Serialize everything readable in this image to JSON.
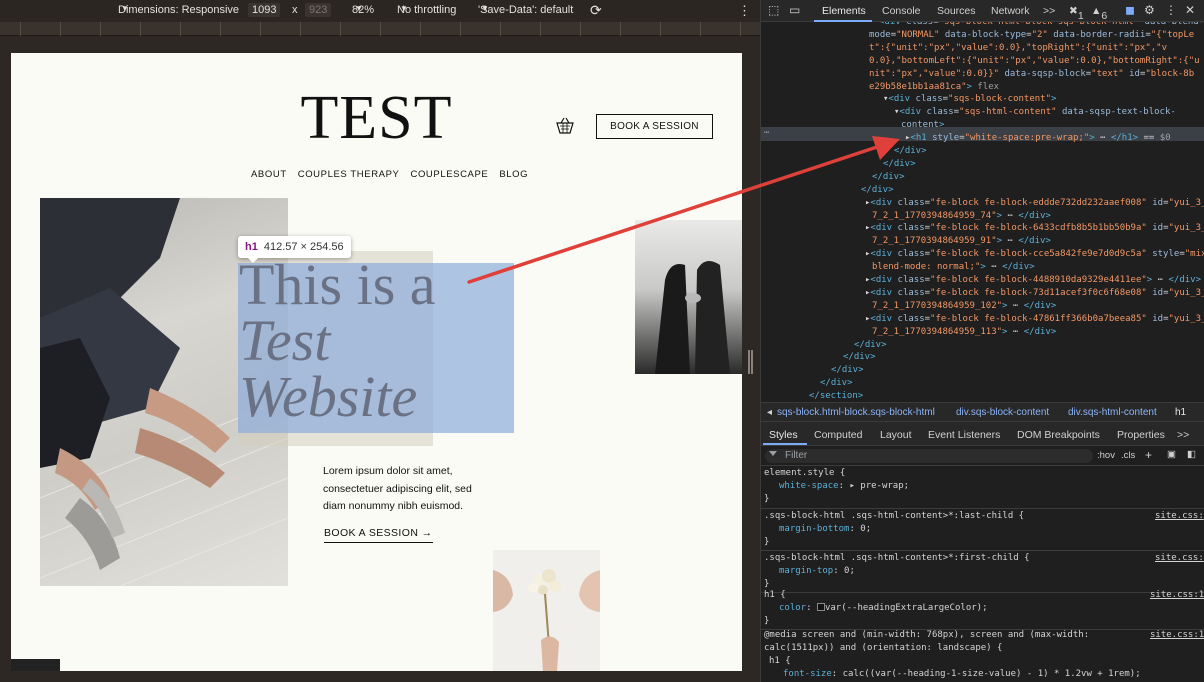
{
  "device_toolbar": {
    "dimensions_label": "Dimensions: Responsive",
    "width": "1093",
    "times": "x",
    "height": "923",
    "zoom": "82%",
    "throttling": "No throttling",
    "save_data": "'Save-Data': default"
  },
  "site": {
    "title": "TEST",
    "book_button": "BOOK A SESSION",
    "nav": [
      "ABOUT",
      "COUPLES THERAPY",
      "COUPLESCAPE",
      "BLOG"
    ],
    "hero_lines": [
      "This is a",
      "Test",
      "Website"
    ],
    "body_text": "Lorem ipsum dolor sit amet, consectetuer adipiscing elit, sed diam nonummy nibh euismod.",
    "link_label": "BOOK A SESSION →"
  },
  "highlight": {
    "tag": "h1",
    "size": "412.57 × 254.56"
  },
  "devtools": {
    "tabs": [
      "Elements",
      "Console",
      "Sources",
      "Network"
    ],
    "more_tabs": ">>",
    "error_count": "1",
    "warning_count": "6",
    "dom_lines": [
      {
        "html": "<span class='t'>&lt;div</span> <span class='a'>class</span>=<span class='v'>\"sqs-block html-block sqs-block-html\"</span> <span class='a'>data-blend-</span>"
      },
      {
        "html": "<span class='a'>mode</span>=<span class='v'>\"NORMAL\"</span> <span class='a'>data-block-type</span>=<span class='v'>\"2\"</span> <span class='a'>data-border-radii</span>=<span class='v'>\"{&quot;topLe</span>"
      },
      {
        "html": "<span class='v'>t&quot;:{&quot;unit&quot;:&quot;px&quot;,&quot;value&quot;:0.0},&quot;topRight&quot;:{&quot;unit&quot;:&quot;px&quot;,&quot;v</span>"
      },
      {
        "html": "<span class='v'>0.0},&quot;bottomLeft&quot;:{&quot;unit&quot;:&quot;px&quot;,&quot;value&quot;:0.0},&quot;bottomRight&quot;:{&quot;u</span>"
      },
      {
        "html": "<span class='v'>nit&quot;:&quot;px&quot;,&quot;value&quot;:0.0}}\"</span> <span class='a'>data-sqsp-block</span>=<span class='v'>\"text\"</span> <span class='a'>id</span>=<span class='v'>\"block-8b</span>"
      },
      {
        "html": "<span class='v'>e29b58e1bb1aa81ca\"</span><span class='t'>&gt;</span> <span class='g'>flex</span>"
      },
      {
        "html": "▾<span class='t'>&lt;div</span> <span class='a'>class</span>=<span class='v'>\"sqs-block-content\"</span><span class='t'>&gt;</span>"
      },
      {
        "html": "▾<span class='t'>&lt;div</span> <span class='a'>class</span>=<span class='v'>\"sqs-html-content\"</span> <span class='a'>data-sqsp-text-block-</span>"
      },
      {
        "html": "<span class='a'>content</span><span class='t'>&gt;</span>"
      },
      {
        "html": "▸<span class='t'>&lt;h1</span> <span class='a'>style</span>=<span class='v'>\"white-space:pre-wrap;\"</span><span class='t'>&gt;</span> ⋯ <span class='t'>&lt;/h1&gt;</span> == <span class='g'>$0</span>"
      },
      {
        "html": "<span class='t'>&lt;/div&gt;</span>"
      },
      {
        "html": "<span class='t'>&lt;/div&gt;</span>"
      },
      {
        "html": "<span class='t'>&lt;/div&gt;</span>"
      },
      {
        "html": "<span class='t'>&lt;/div&gt;</span>"
      },
      {
        "html": "▸<span class='t'>&lt;div</span> <span class='a'>class</span>=<span class='v'>\"fe-block fe-block-eddde732dd232aaef008\"</span> <span class='a'>id</span>=<span class='v'>\"yui_3_</span>"
      },
      {
        "html": "<span class='v'>7_2_1_1770394864959_74\"</span><span class='t'>&gt;</span> ⋯ <span class='t'>&lt;/div&gt;</span>"
      },
      {
        "html": "▸<span class='t'>&lt;div</span> <span class='a'>class</span>=<span class='v'>\"fe-block fe-block-6433cdfb8b5b1bb50b9a\"</span> <span class='a'>id</span>=<span class='v'>\"yui_3_</span>"
      },
      {
        "html": "<span class='v'>7_2_1_1770394864959_91\"</span><span class='t'>&gt;</span> ⋯ <span class='t'>&lt;/div&gt;</span>"
      },
      {
        "html": "▸<span class='t'>&lt;div</span> <span class='a'>class</span>=<span class='v'>\"fe-block fe-block-cce5a842fe9e7d0d9c5a\"</span> <span class='a'>style</span>=<span class='v'>\"mix-</span>"
      },
      {
        "html": "<span class='v'>blend-mode: normal;\"</span><span class='t'>&gt;</span> ⋯ <span class='t'>&lt;/div&gt;</span>"
      },
      {
        "html": "▸<span class='t'>&lt;div</span> <span class='a'>class</span>=<span class='v'>\"fe-block fe-block-4488910da9329e4411ee\"</span><span class='t'>&gt;</span> ⋯ <span class='t'>&lt;/div&gt;</span>"
      },
      {
        "html": "▸<span class='t'>&lt;div</span> <span class='a'>class</span>=<span class='v'>\"fe-block fe-block-73d11acef3f0c6f68e08\"</span> <span class='a'>id</span>=<span class='v'>\"yui_3_</span>"
      },
      {
        "html": "<span class='v'>7_2_1_1770394864959_102\"</span><span class='t'>&gt;</span> ⋯ <span class='t'>&lt;/div&gt;</span>"
      },
      {
        "html": "▸<span class='t'>&lt;div</span> <span class='a'>class</span>=<span class='v'>\"fe-block fe-block-47861ff366b0a7beea85\"</span> <span class='a'>id</span>=<span class='v'>\"yui_3_</span>"
      },
      {
        "html": "<span class='v'>7_2_1_1770394864959_113\"</span><span class='t'>&gt;</span> ⋯ <span class='t'>&lt;/div&gt;</span>"
      },
      {
        "html": "<span class='t'>&lt;/div&gt;</span>"
      },
      {
        "html": "<span class='t'>&lt;/div&gt;</span>"
      },
      {
        "html": "<span class='t'>&lt;/div&gt;</span>"
      },
      {
        "html": "<span class='t'>&lt;/div&gt;</span>"
      },
      {
        "html": "<span class='t'>&lt;/section&gt;</span>"
      }
    ],
    "breadcrumbs": [
      "sqs-block.html-block.sqs-block-html",
      "div.sqs-block-content",
      "div.sqs-html-content",
      "h1"
    ],
    "styles_tabs": [
      "Styles",
      "Computed",
      "Layout",
      "Event Listeners",
      "DOM Breakpoints",
      "Properties"
    ],
    "filter_placeholder": "Filter",
    "filter_hov": ":hov",
    "filter_cls": ".cls",
    "rules": [
      {
        "selector": "element.style {",
        "source": "",
        "prop": "white-space",
        "value": "▸ pre-wrap;"
      },
      {
        "selector": ".sqs-block-html .sqs-html-content>*:last-child {",
        "source": "site.css:",
        "prop": "margin-bottom",
        "value": "0;"
      },
      {
        "selector": ".sqs-block-html .sqs-html-content>*:first-child {",
        "source": "site.css:",
        "prop": "margin-top",
        "value": "0;"
      },
      {
        "selector": "h1 {",
        "source": "site.css:1",
        "prop": "color",
        "value": "var(--headingExtraLargeColor);"
      }
    ],
    "media_rule": {
      "line1": "@media screen and (min-width: 768px), screen and (max-width:",
      "line2": "calc(1511px)) and (orientation: landscape) {",
      "selector": "h1 {",
      "prop": "font-size",
      "value": "calc((var(--heading-1-size-value) - 1) * 1.2vw + 1rem);",
      "source": "site.css:1"
    }
  },
  "colors": {
    "accent": "#7cacf8",
    "highlight_content": "#8cacdb",
    "arrow": "#e0403a"
  }
}
